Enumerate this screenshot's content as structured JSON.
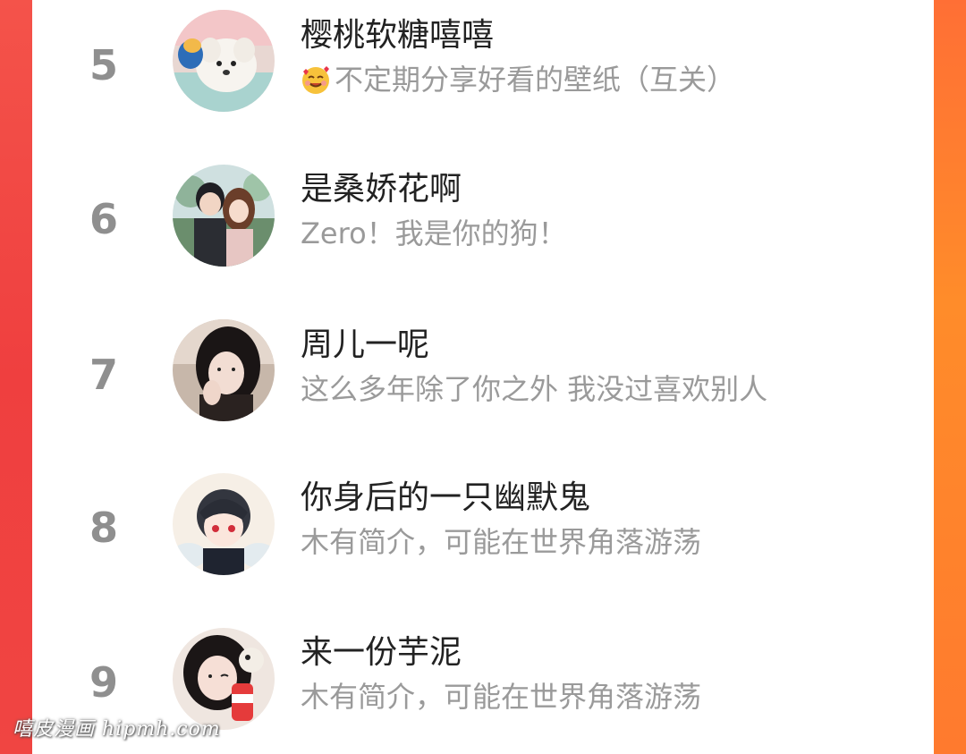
{
  "ranking": {
    "rows": [
      {
        "rank": "5",
        "name": "樱桃软糖嘻嘻",
        "bio": "不定期分享好看的壁纸（互关）",
        "bio_emoji": "smiling-face-with-hearts-icon",
        "avatar": "white-puppy-avatar"
      },
      {
        "rank": "6",
        "name": "是桑娇花啊",
        "bio": "Zero！我是你的狗！",
        "avatar": "couple-illustration-avatar"
      },
      {
        "rank": "7",
        "name": "周儿一呢",
        "bio": "这么多年除了你之外 我没过喜欢别人",
        "avatar": "girl-selfie-avatar"
      },
      {
        "rank": "8",
        "name": "你身后的一只幽默鬼",
        "bio": "木有简介，可能在世界角落游荡",
        "avatar": "anime-boy-avatar"
      },
      {
        "rank": "9",
        "name": "来一份芋泥",
        "bio": "木有简介，可能在世界角落游荡",
        "avatar": "girl-with-drink-avatar"
      }
    ]
  },
  "watermark": "嘻皮漫画 hipmh.com",
  "colors": {
    "left_edge": "#f24a44",
    "right_edge": "#ff7a30",
    "rank_text": "#8f8f8f",
    "name_text": "#222222",
    "bio_text": "#9a9a9a"
  }
}
